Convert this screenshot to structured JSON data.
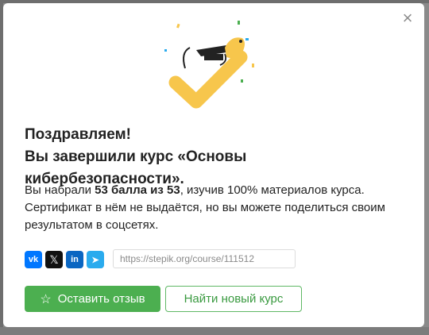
{
  "modal": {
    "close_symbol": "×",
    "title_line1": "Поздравляем!",
    "title_line2": "Вы завершили курс «Основы кибербезопасности».",
    "text_prefix": "Вы набрали ",
    "text_score": "53 балла из 53",
    "text_suffix": ", изучив 100% материалов курса.",
    "text_line2": "Сертификат в нём не выдаётся, но вы можете поделиться своим",
    "text_line3": "результатом в соцсетях.",
    "share": {
      "vk_label": "vk",
      "x_label": "𝕏",
      "li_label": "in",
      "tg_label": "➤",
      "link_value": "https://stepik.org/course/111512"
    },
    "review_button": "Оставить отзыв",
    "review_icon": "☆",
    "new_course_button": "Найти новый курс",
    "colors": {
      "primary": "#4caf50",
      "accent_yellow": "#f7c64c",
      "vk": "#0077ff",
      "linkedin": "#0a66c2",
      "telegram": "#2aabee"
    }
  }
}
